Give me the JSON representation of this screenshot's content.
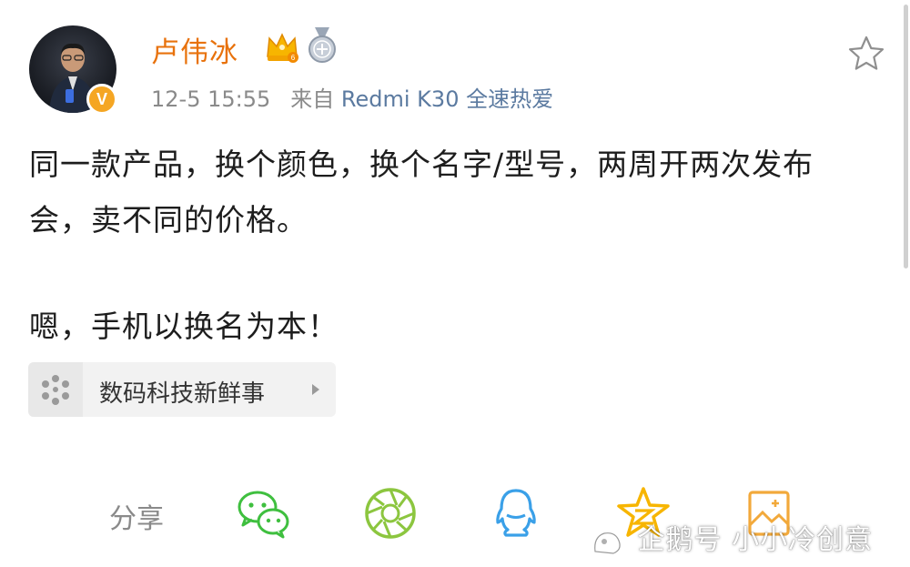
{
  "post": {
    "author": "卢伟冰",
    "timestamp": "12-5 15:55",
    "source_prefix": "来自",
    "source_device": "Redmi K30 全速热爱",
    "content_line1": "同一款产品，换个颜色，换个名字/型号，两周开两次发布",
    "content_line2": "会，卖不同的价格。",
    "content_line3": "嗯，手机以换名为本！"
  },
  "topic": {
    "label": "数码科技新鲜事"
  },
  "share": {
    "label": "分享",
    "targets": [
      "wechat-icon",
      "moments-icon",
      "qq-icon",
      "qzone-icon",
      "picture-icon"
    ]
  },
  "watermark": {
    "text": "企鹅号 小小冷创意"
  },
  "badges": {
    "vip_letter": "V"
  },
  "colors": {
    "author": "#e8720c",
    "link": "#5b7aa0",
    "wechat": "#3fbf3f",
    "moments": "#8cc63f",
    "qq": "#3aa0e8",
    "qzone": "#f7b500",
    "vip": "#f5a623"
  }
}
